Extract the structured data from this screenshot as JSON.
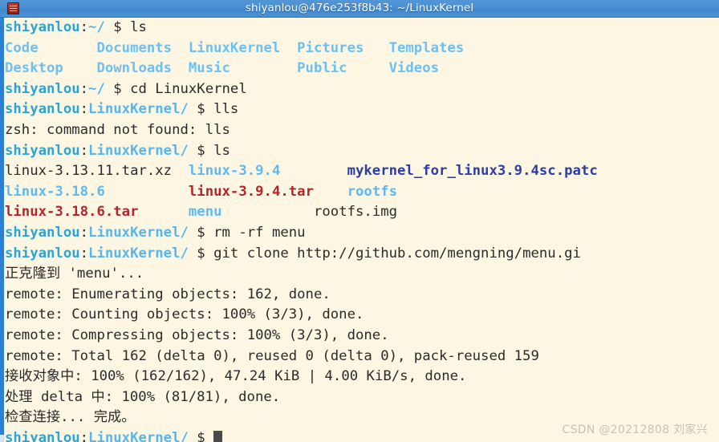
{
  "window": {
    "title": "shiyanlou@476e253f8b43: ~/LinuxKernel",
    "icon": "terminal-icon"
  },
  "theme": {
    "background": "#fdf6e3",
    "foreground": "#2b2b2b",
    "titlebar_bg": "#4a8fd2",
    "titlebar_fg": "#ffffff",
    "prompt_user": "#2aa5d8",
    "prompt_path": "#56b6f0",
    "dir_color": "#6cc0f5",
    "archive_color": "#b4262a",
    "patch_color": "#2b3ea8",
    "scrollbar_color": "#2b7fd4",
    "watermark_color": "#c9c3b2"
  },
  "prompt": {
    "user": "shiyanlou",
    "colon": ":",
    "home_path": "~/",
    "kernel_path": "LinuxKernel/",
    "symbol": "$"
  },
  "lines": [
    {
      "id": "l01",
      "segments": [
        {
          "text": "shiyanlou",
          "cls": "c-user"
        },
        {
          "text": ":",
          "cls": "c-punct"
        },
        {
          "text": "~/",
          "cls": "c-path"
        },
        {
          "text": " $ ls",
          "cls": "c-default"
        }
      ]
    },
    {
      "id": "l02",
      "segments": [
        {
          "text": "Code       Documents  LinuxKernel  Pictures   Templates",
          "cls": "c-dir"
        }
      ]
    },
    {
      "id": "l03",
      "segments": [
        {
          "text": "Desktop    Downloads  Music        Public     Videos",
          "cls": "c-dir"
        }
      ]
    },
    {
      "id": "l04",
      "segments": [
        {
          "text": "shiyanlou",
          "cls": "c-user"
        },
        {
          "text": ":",
          "cls": "c-punct"
        },
        {
          "text": "~/",
          "cls": "c-path"
        },
        {
          "text": " $ cd LinuxKernel",
          "cls": "c-default"
        }
      ]
    },
    {
      "id": "l05",
      "segments": [
        {
          "text": "shiyanlou",
          "cls": "c-user"
        },
        {
          "text": ":",
          "cls": "c-punct"
        },
        {
          "text": "LinuxKernel/",
          "cls": "c-path"
        },
        {
          "text": " $ lls",
          "cls": "c-default"
        }
      ]
    },
    {
      "id": "l06",
      "segments": [
        {
          "text": "zsh: command not found: lls",
          "cls": "c-default"
        }
      ]
    },
    {
      "id": "l07",
      "segments": [
        {
          "text": "shiyanlou",
          "cls": "c-user"
        },
        {
          "text": ":",
          "cls": "c-punct"
        },
        {
          "text": "LinuxKernel/",
          "cls": "c-path"
        },
        {
          "text": " $ ls",
          "cls": "c-default"
        }
      ]
    },
    {
      "id": "l08",
      "segments": [
        {
          "text": "linux-3.13.11.tar.xz",
          "cls": "c-default"
        },
        {
          "text": "  ",
          "cls": "c-default"
        },
        {
          "text": "linux-3.9.4",
          "cls": "c-lsdir"
        },
        {
          "text": "        ",
          "cls": "c-default"
        },
        {
          "text": "mykernel_for_linux3.9.4sc.patc",
          "cls": "c-patch"
        }
      ]
    },
    {
      "id": "l09",
      "segments": [
        {
          "text": "linux-3.18.6",
          "cls": "c-lsdir"
        },
        {
          "text": "          ",
          "cls": "c-default"
        },
        {
          "text": "linux-3.9.4.tar",
          "cls": "c-archive"
        },
        {
          "text": "    ",
          "cls": "c-default"
        },
        {
          "text": "rootfs",
          "cls": "c-lsdir"
        }
      ]
    },
    {
      "id": "l10",
      "segments": [
        {
          "text": "linux-3.18.6.tar",
          "cls": "c-archive"
        },
        {
          "text": "      ",
          "cls": "c-default"
        },
        {
          "text": "menu",
          "cls": "c-lsdir"
        },
        {
          "text": "           ",
          "cls": "c-default"
        },
        {
          "text": "rootfs.img",
          "cls": "c-default"
        }
      ]
    },
    {
      "id": "l11",
      "segments": [
        {
          "text": "shiyanlou",
          "cls": "c-user"
        },
        {
          "text": ":",
          "cls": "c-punct"
        },
        {
          "text": "LinuxKernel/",
          "cls": "c-path"
        },
        {
          "text": " $ rm -rf menu",
          "cls": "c-default"
        }
      ]
    },
    {
      "id": "l12",
      "segments": [
        {
          "text": "shiyanlou",
          "cls": "c-user"
        },
        {
          "text": ":",
          "cls": "c-punct"
        },
        {
          "text": "LinuxKernel/",
          "cls": "c-path"
        },
        {
          "text": " $ git clone http://github.com/mengning/menu.gi",
          "cls": "c-default"
        }
      ]
    },
    {
      "id": "l13",
      "segments": [
        {
          "text": "正克隆到 'menu'...",
          "cls": "c-default"
        }
      ]
    },
    {
      "id": "l14",
      "segments": [
        {
          "text": "remote: Enumerating objects: 162, done.",
          "cls": "c-default"
        }
      ]
    },
    {
      "id": "l15",
      "segments": [
        {
          "text": "remote: Counting objects: 100% (3/3), done.",
          "cls": "c-default"
        }
      ]
    },
    {
      "id": "l16",
      "segments": [
        {
          "text": "remote: Compressing objects: 100% (3/3), done.",
          "cls": "c-default"
        }
      ]
    },
    {
      "id": "l17",
      "segments": [
        {
          "text": "remote: Total 162 (delta 0), reused 0 (delta 0), pack-reused 159",
          "cls": "c-default"
        }
      ]
    },
    {
      "id": "l18",
      "segments": [
        {
          "text": "接收对象中: 100% (162/162), 47.24 KiB | 4.00 KiB/s, done.",
          "cls": "c-default"
        }
      ]
    },
    {
      "id": "l19",
      "segments": [
        {
          "text": "处理 delta 中: 100% (81/81), done.",
          "cls": "c-default"
        }
      ]
    },
    {
      "id": "l20",
      "segments": [
        {
          "text": "检查连接... 完成。",
          "cls": "c-default"
        }
      ]
    },
    {
      "id": "l21",
      "cursor": true,
      "segments": [
        {
          "text": "shiyanlou",
          "cls": "c-user"
        },
        {
          "text": ":",
          "cls": "c-punct"
        },
        {
          "text": "LinuxKernel/",
          "cls": "c-path"
        },
        {
          "text": " $ ",
          "cls": "c-default"
        }
      ]
    }
  ],
  "watermark": {
    "text": "CSDN @20212808 刘家兴"
  }
}
